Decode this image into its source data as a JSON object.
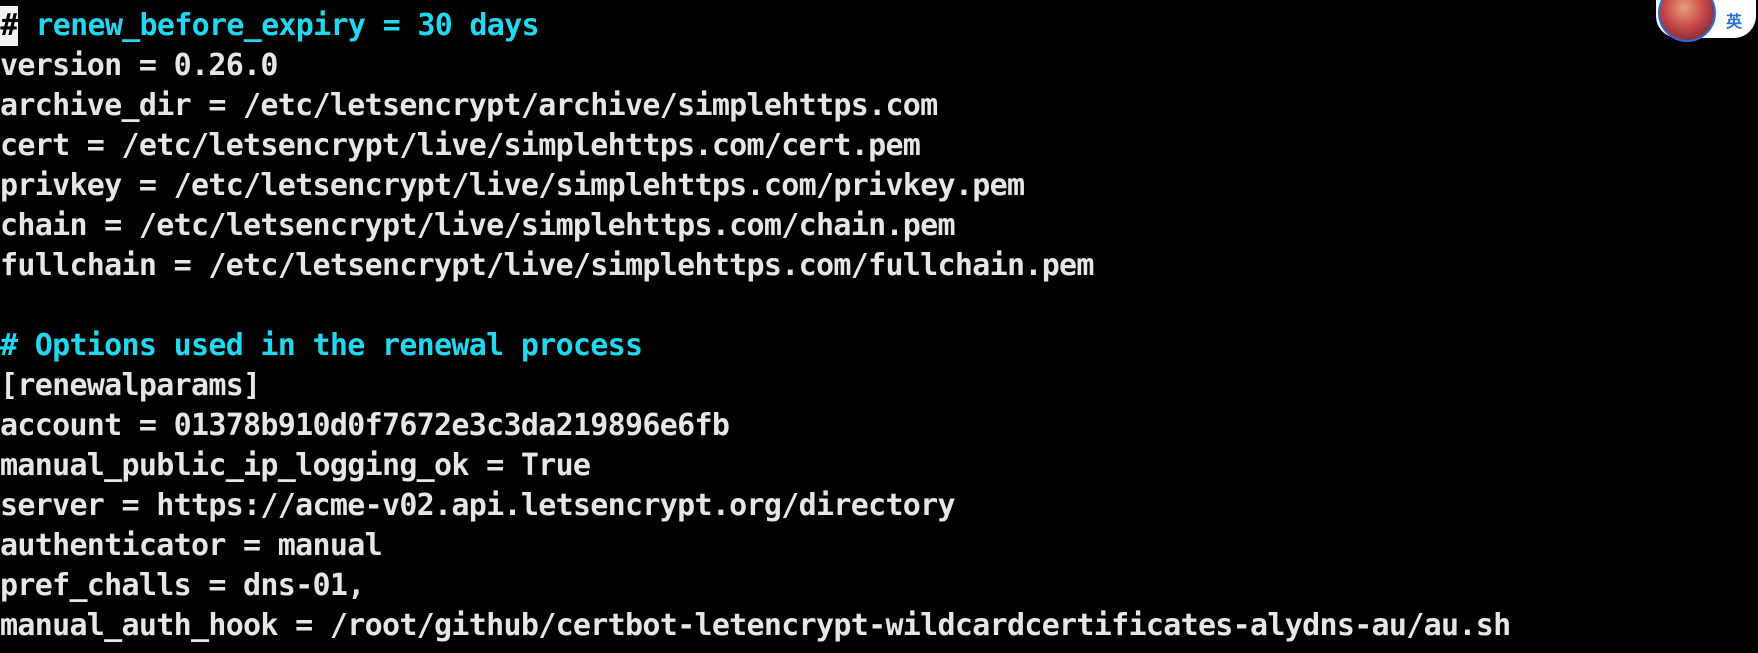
{
  "terminal": {
    "lines": [
      {
        "text": "renew_before_expiry = 30 days",
        "style": "comment",
        "cursor": "#"
      },
      {
        "text": "version = 0.26.0",
        "style": "normal"
      },
      {
        "text": "archive_dir = /etc/letsencrypt/archive/simplehttps.com",
        "style": "normal"
      },
      {
        "text": "cert = /etc/letsencrypt/live/simplehttps.com/cert.pem",
        "style": "normal"
      },
      {
        "text": "privkey = /etc/letsencrypt/live/simplehttps.com/privkey.pem",
        "style": "normal"
      },
      {
        "text": "chain = /etc/letsencrypt/live/simplehttps.com/chain.pem",
        "style": "normal"
      },
      {
        "text": "fullchain = /etc/letsencrypt/live/simplehttps.com/fullchain.pem",
        "style": "normal"
      },
      {
        "text": "",
        "style": "normal"
      },
      {
        "text": "# Options used in the renewal process",
        "style": "comment"
      },
      {
        "text": "[renewalparams]",
        "style": "normal"
      },
      {
        "text": "account = 01378b910d0f7672e3c3da219896e6fb",
        "style": "normal"
      },
      {
        "text": "manual_public_ip_logging_ok = True",
        "style": "normal"
      },
      {
        "text": "server = https://acme-v02.api.letsencrypt.org/directory",
        "style": "normal"
      },
      {
        "text": "authenticator = manual",
        "style": "normal"
      },
      {
        "text": "pref_challs = dns-01,",
        "style": "normal"
      },
      {
        "text": "manual_auth_hook = /root/github/certbot-letencrypt-wildcardcertificates-alydns-au/au.sh",
        "style": "normal"
      }
    ]
  },
  "ime": {
    "label": "英",
    "icon": "user-avatar-icon"
  },
  "colors": {
    "background": "#000000",
    "text": "#e6e6e6",
    "comment": "#22d8f0",
    "ime_accent": "#2a6fd6"
  }
}
